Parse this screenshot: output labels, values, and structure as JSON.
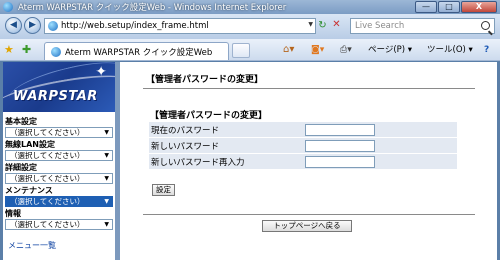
{
  "window": {
    "title": "Aterm WARPSTAR クイック設定Web - Windows Internet Explorer",
    "min_glyph": "—",
    "max_glyph": "□",
    "close_glyph": "X"
  },
  "address_bar": {
    "url": "http://web.setup/index_frame.html",
    "search_placeholder": "Live Search"
  },
  "tab_bar": {
    "tab_label": "Aterm WARPSTAR クイック設定Web",
    "page_menu": "ページ(P) ▾",
    "tools_menu": "ツール(O) ▾",
    "help_glyph": "?"
  },
  "sidebar": {
    "logo_text": "WARPSTAR",
    "groups": [
      {
        "heading": "基本設定",
        "select_value": "（選択してください）"
      },
      {
        "heading": "無線LAN設定",
        "select_value": "（選択してください）"
      },
      {
        "heading": "詳細設定",
        "select_value": "（選択してください）"
      },
      {
        "heading": "メンテナンス",
        "select_value": "（選択してください）"
      },
      {
        "heading": "情報",
        "select_value": "（選択してください）"
      }
    ],
    "menu_link": "メニュー一覧"
  },
  "main": {
    "header": "【管理者パスワードの変更】",
    "section_title": "【管理者パスワードの変更】",
    "fields": [
      {
        "label": "現在のパスワード",
        "value": ""
      },
      {
        "label": "新しいパスワード",
        "value": ""
      },
      {
        "label": "新しいパスワード再入力",
        "value": ""
      }
    ],
    "set_button": "設定",
    "top_button": "トップページへ戻る"
  },
  "colors": {
    "frame": "#5b7fa8",
    "logo_bg": "#1a3b8c",
    "field_row_bg": "#e3e9f2",
    "active_select": "#1e5fb3",
    "link": "#0a3fa0"
  }
}
